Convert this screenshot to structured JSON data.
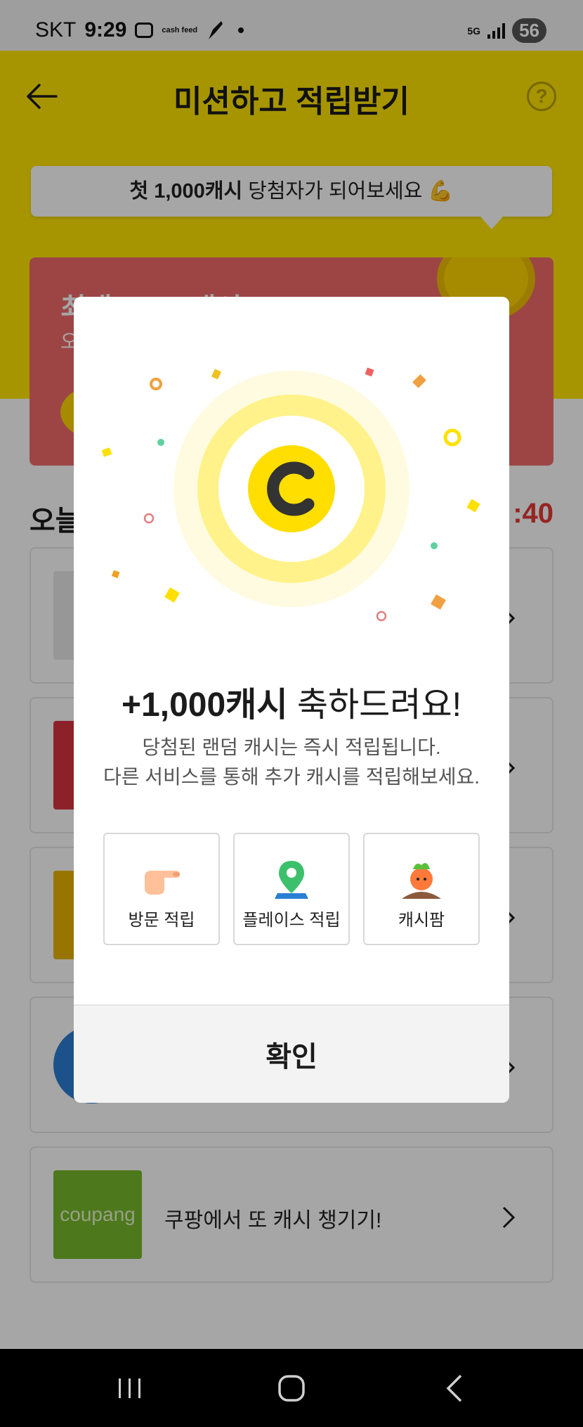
{
  "status_bar": {
    "carrier": "SKT",
    "time": "9:29",
    "cashfeed_label": "cash feed",
    "network": "5G",
    "battery": "56"
  },
  "header": {
    "title": "미션하고 적립받기",
    "help_icon": "?"
  },
  "promo": {
    "prefix": "첫 1,000캐시",
    "suffix": " 당첨자가 되어보세요 💪"
  },
  "banner": {
    "title": "최대 1,000캐시",
    "subtitle": "오"
  },
  "section": {
    "heading": "오늘",
    "timer": ":40"
  },
  "missions": [
    {
      "thumb_color": "#e8e8e8",
      "label": ""
    },
    {
      "thumb_color": "#d9333f",
      "label": ""
    },
    {
      "thumb_color": "#e8b400",
      "label": ""
    },
    {
      "thumb_color": "#2a7fd4",
      "label": ""
    },
    {
      "thumb_color": "#77b82a",
      "label": "쿠팡에서 또 캐시 챙기기!",
      "logo": "coupang"
    }
  ],
  "dialog": {
    "title_amount": "+1,000캐시",
    "title_rest": " 축하드려요!",
    "desc_line1": "당첨된 랜덤 캐시는 즉시 적립됩니다.",
    "desc_line2": "다른 서비스를 통해 추가 캐시를 적립해보세요.",
    "shortcuts": [
      {
        "label": "방문 적립",
        "icon": "pointing-hand-icon"
      },
      {
        "label": "플레이스 적립",
        "icon": "map-pin-icon"
      },
      {
        "label": "캐시팜",
        "icon": "carrot-icon"
      }
    ],
    "confirm_label": "확인"
  },
  "colors": {
    "accent_yellow": "#ffe500",
    "coin_yellow": "#ffde00",
    "banner_red": "#f26b6b"
  }
}
